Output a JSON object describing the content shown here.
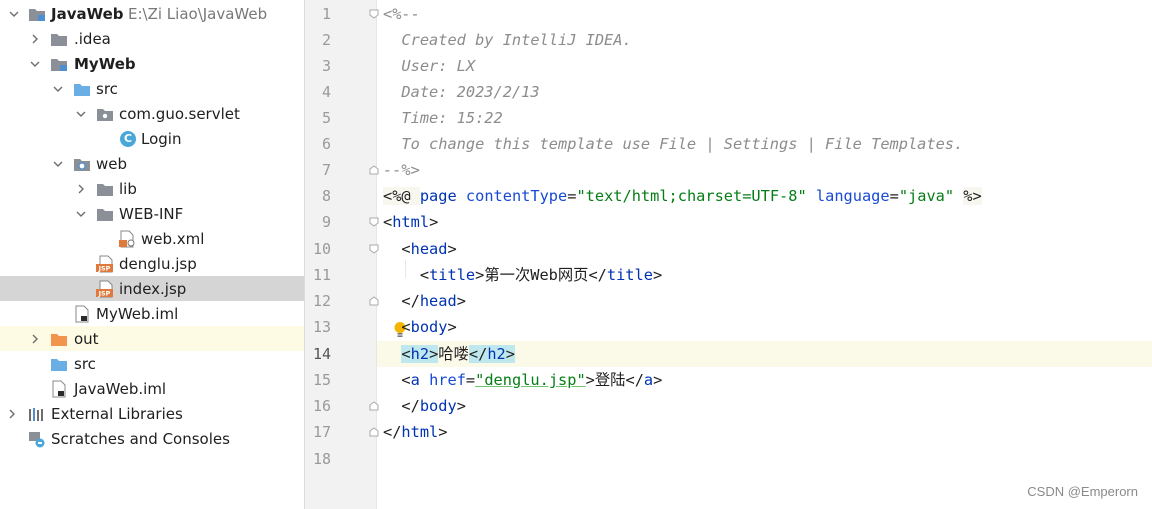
{
  "project_tree": {
    "root": {
      "label": "JavaWeb",
      "path": "E:\\Zi Liao\\JavaWeb"
    },
    "items": [
      {
        "label": ".idea"
      },
      {
        "label": "MyWeb"
      },
      {
        "label": "src"
      },
      {
        "label": "com.guo.servlet"
      },
      {
        "label": "Login",
        "icon_letter": "C"
      },
      {
        "label": "web"
      },
      {
        "label": "lib"
      },
      {
        "label": "WEB-INF"
      },
      {
        "label": "web.xml"
      },
      {
        "label": "denglu.jsp"
      },
      {
        "label": "index.jsp"
      },
      {
        "label": "MyWeb.iml"
      },
      {
        "label": "out"
      },
      {
        "label": "src"
      },
      {
        "label": "JavaWeb.iml"
      },
      {
        "label": "External Libraries"
      },
      {
        "label": "Scratches and Consoles"
      }
    ],
    "selected_item": "index.jsp"
  },
  "editor": {
    "line_numbers": [
      "1",
      "2",
      "3",
      "4",
      "5",
      "6",
      "7",
      "8",
      "9",
      "10",
      "11",
      "12",
      "13",
      "14",
      "15",
      "16",
      "17",
      "18"
    ],
    "current_line": "14",
    "code": {
      "l1": "<%--",
      "l2": "  Created by IntelliJ IDEA.",
      "l3": "  User: LX",
      "l4": "  Date: 2023/2/13",
      "l5": "  Time: 15:22",
      "l6": "  To change this template use File | Settings | File Templates.",
      "l7": "--%>",
      "l8": {
        "open": "<%@ ",
        "kw": "page",
        "a1": "contentType",
        "v1": "\"text/html;charset=UTF-8\"",
        "a2": "language",
        "v2": "\"java\"",
        "close": "%>"
      },
      "l9": "html",
      "l10": "head",
      "l11": {
        "tag": "title",
        "text": "第一次Web网页"
      },
      "l12": "head",
      "l13": "body",
      "l14": {
        "tag": "h2",
        "text": "哈喽"
      },
      "l15": {
        "tag": "a",
        "attr": "href",
        "value": "\"denglu.jsp\"",
        "text": "登陆"
      },
      "l16": "body",
      "l17": "html"
    }
  },
  "watermark": "CSDN @Emperorn",
  "colors": {
    "tag": "#0033b3",
    "string": "#067d17",
    "comment": "#8c8c8c",
    "selection": "#d5d5d5"
  }
}
